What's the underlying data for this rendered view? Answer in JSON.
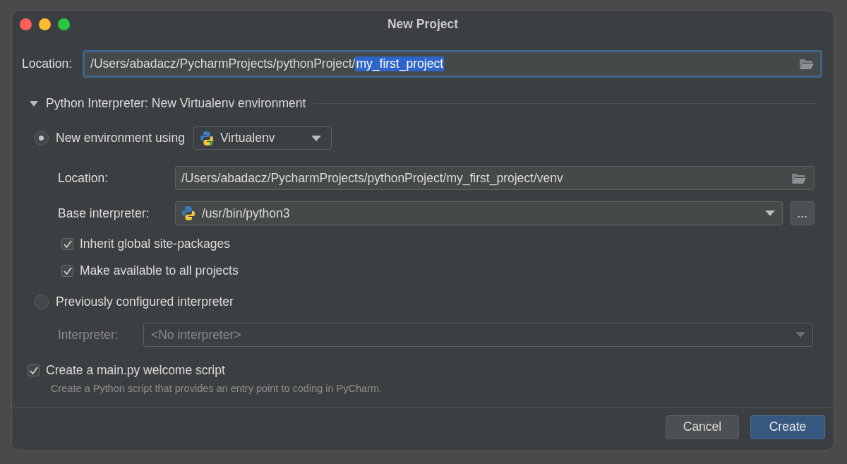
{
  "window": {
    "title": "New Project"
  },
  "location": {
    "label": "Location:",
    "value": "/Users/abadacz/PycharmProjects/pythonProject/",
    "selected_text": "my_first_project"
  },
  "interpreter_section": {
    "title": "Python Interpreter: New Virtualenv environment",
    "expanded": true
  },
  "new_environment": {
    "label": "New environment using",
    "selected": true,
    "tool": "Virtualenv",
    "location": {
      "label": "Location:",
      "value": "/Users/abadacz/PycharmProjects/pythonProject/my_first_project/venv"
    },
    "base_interpreter": {
      "label": "Base interpreter:",
      "value": "/usr/bin/python3",
      "browse": "..."
    },
    "checkboxes": [
      {
        "label": "Inherit global site-packages",
        "checked": true
      },
      {
        "label": "Make available to all projects",
        "checked": true
      }
    ]
  },
  "existing_interpreter": {
    "label": "Previously configured interpreter",
    "selected": false,
    "interpreter": {
      "label": "Interpreter:",
      "placeholder": "<No interpreter>",
      "disabled": true
    }
  },
  "welcome_script": {
    "label": "Create a main.py welcome script",
    "checked": true,
    "description": "Create a Python script that provides an entry point to coding in PyCharm."
  },
  "buttons": [
    {
      "label": "Cancel",
      "kind": "default"
    },
    {
      "label": "Create",
      "kind": "primary"
    }
  ]
}
